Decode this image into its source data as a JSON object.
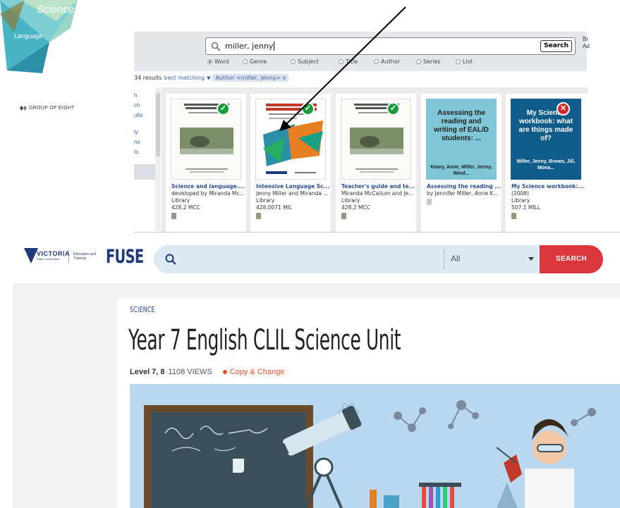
{
  "logo": {
    "science": "Science",
    "language": "Language",
    "group_of_eight": "GROUP OF EIGHT"
  },
  "catalogue": {
    "search_query": "miller, jenny",
    "search_button": "Search",
    "side_clip": [
      "Br",
      "Ad"
    ],
    "search_types": [
      "Word",
      "Genre",
      "Subject",
      "Title",
      "Author",
      "Series",
      "List"
    ],
    "selected_type": "Word",
    "results_count": "34 results",
    "best_matching": "best matching",
    "filter_chip": "Author <miller, jenny>",
    "filter_chip_close": "x",
    "left_nav": [
      "h",
      "ch",
      "ults",
      "ly",
      "ns",
      "ts"
    ],
    "items": [
      {
        "title": "Science and language....",
        "by": "developed by Miranda Mc...",
        "loc": "Library",
        "call": "428.2 MCC",
        "status": "available",
        "cover_title": "",
        "cover_author": ""
      },
      {
        "title": "Intensive Language Sc...",
        "by": "Jenny Miller and Miranda ...",
        "loc": "Library",
        "call": "428.0071 MIL",
        "status": "available",
        "cover_title": "",
        "cover_author": ""
      },
      {
        "title": "Teacher's guide and te...",
        "by": "Miranda McCallum and Je...",
        "loc": "Library",
        "call": "428.2 MCC",
        "status": "available",
        "cover_title": "",
        "cover_author": ""
      },
      {
        "title": "Assessing the reading ...",
        "by": "by Jennifer Miller, Anne K...",
        "loc": "",
        "call": "",
        "status": "none",
        "cover_title": "Assessing the reading and writing of EAL/D students: ...",
        "cover_author": "Keary, Anne, Miller, Jenny, Wind..."
      },
      {
        "title": "My Science workbook:...",
        "by": "(2008)",
        "loc": "Library",
        "call": "507.1 MILL",
        "status": "unavailable",
        "cover_title": "My Science workbook: what are things made of?",
        "cover_author": "Miller, Jenny, Brown, Jill, Mona..."
      }
    ],
    "status_icons": {
      "available": "checkmark-icon",
      "unavailable": "cross-icon"
    }
  },
  "fuse": {
    "vic_word": "VICTORIA",
    "vic_sub": "State Government",
    "edu": "Education and Training",
    "brand": "FUSE",
    "search_placeholder": "",
    "filter_value": "All",
    "search_button": "SEARCH",
    "kicker": "SCIENCE",
    "title": "Year 7 English CLIL Science Unit",
    "level": "Level 7, 8",
    "views": "1108 VIEWS",
    "copy_change": "Copy & Change"
  },
  "colors": {
    "accent_blue": "#1f3a7a",
    "search_red": "#d9363e",
    "copy_orange": "#e2502a",
    "link_blue": "#2c4f8c",
    "ok_green": "#1a9c3a",
    "cross_red": "#d6242d"
  }
}
